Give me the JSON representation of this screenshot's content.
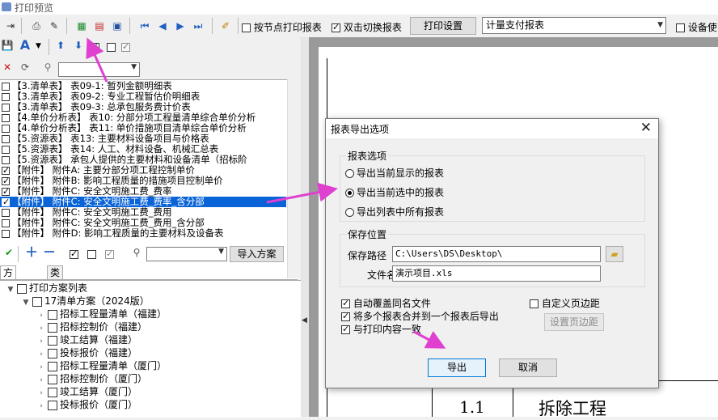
{
  "window": {
    "title": "打印预览"
  },
  "toolbar": {
    "print_by_node": "按节点打印报表",
    "dblclick_switch": "双击切换报表",
    "print_settings": "打印设置",
    "report_combo": "计量支付报表",
    "device_label": "设备使"
  },
  "left_panel": {
    "reports": [
      {
        "text": "【3.清单表】 表09-1: 暂列金额明细表",
        "checked": false
      },
      {
        "text": "【3.清单表】 表09-2: 专业工程暂估价明细表",
        "checked": false
      },
      {
        "text": "【3.清单表】 表09-3: 总承包服务费计价表",
        "checked": false
      },
      {
        "text": "【4.单价分析表】 表10: 分部分项工程量清单综合单价分析",
        "checked": false
      },
      {
        "text": "【4.单价分析表】 表11: 单价措施项目清单综合单价分析",
        "checked": false
      },
      {
        "text": "【5.资源表】 表13: 主要材料设备项目与价格表",
        "checked": false
      },
      {
        "text": "【5.资源表】 表14: 人工、材料设备、机械汇总表",
        "checked": false
      },
      {
        "text": "【5.资源表】 承包人提供的主要材料和设备清单（招标阶",
        "checked": false
      },
      {
        "text": "【附件】 附件A: 主要分部分项工程控制单价",
        "checked": true
      },
      {
        "text": "【附件】 附件B: 影响工程质量的措施项目控制单价",
        "checked": true
      },
      {
        "text": "【附件】 附件C: 安全文明施工费_费率",
        "checked": true
      },
      {
        "text": "【附件】 附件C: 安全文明施工费_费率_含分部",
        "checked": true,
        "selected": true
      },
      {
        "text": "【附件】 附件C: 安全文明施工费_费用",
        "checked": false
      },
      {
        "text": "【附件】 附件C: 安全文明施工费_费用_含分部",
        "checked": false
      },
      {
        "text": "【附件】 附件D: 影响工程质量的主要材料及设备表",
        "checked": false
      }
    ],
    "import_button": "导入方案",
    "tabs": [
      "方案列表",
      "类型列表"
    ],
    "tree": [
      {
        "text": "打印方案列表",
        "level": 0,
        "expander": "▼"
      },
      {
        "text": "17清单方案（2024版）",
        "level": 1,
        "expander": "▼"
      },
      {
        "text": "招标工程量清单（福建）",
        "level": 2,
        "expander": "›"
      },
      {
        "text": "招标控制价（福建）",
        "level": 2,
        "expander": "›"
      },
      {
        "text": "竣工结算（福建）",
        "level": 2,
        "expander": "›"
      },
      {
        "text": "投标报价（福建）",
        "level": 2,
        "expander": "›"
      },
      {
        "text": "招标工程量清单（厦门）",
        "level": 2,
        "expander": "›"
      },
      {
        "text": "招标控制价（厦门）",
        "level": 2,
        "expander": "›"
      },
      {
        "text": "竣工结算（厦门）",
        "level": 2,
        "expander": "›"
      },
      {
        "text": "投标报价（厦门）",
        "level": 2,
        "expander": "›"
      }
    ]
  },
  "preview": {
    "row_number": "1.1",
    "row_text": "拆除工程"
  },
  "dialog": {
    "title": "报表导出选项",
    "report_options_label": "报表选项",
    "radio_current_shown": "导出当前显示的报表",
    "radio_current_selected": "导出当前选中的报表",
    "radio_all": "导出列表中所有报表",
    "save_location_label": "保存位置",
    "save_path_label": "保存路径",
    "save_path_value": "C:\\Users\\DS\\Desktop\\",
    "file_name_label": "文件名",
    "file_name_value": "演示项目.xls",
    "overwrite_label": "自动覆盖同名文件",
    "merge_label": "将多个报表合并到一个报表后导出",
    "match_print_label": "与打印内容一致",
    "custom_margin_label": "自定义页边距",
    "set_margin_button": "设置页边距",
    "export_button": "导出",
    "cancel_button": "取消"
  },
  "colors": {
    "selection": "#0a64d8",
    "arrow": "#e040d0",
    "accent_blue": "#1f5fbf"
  }
}
